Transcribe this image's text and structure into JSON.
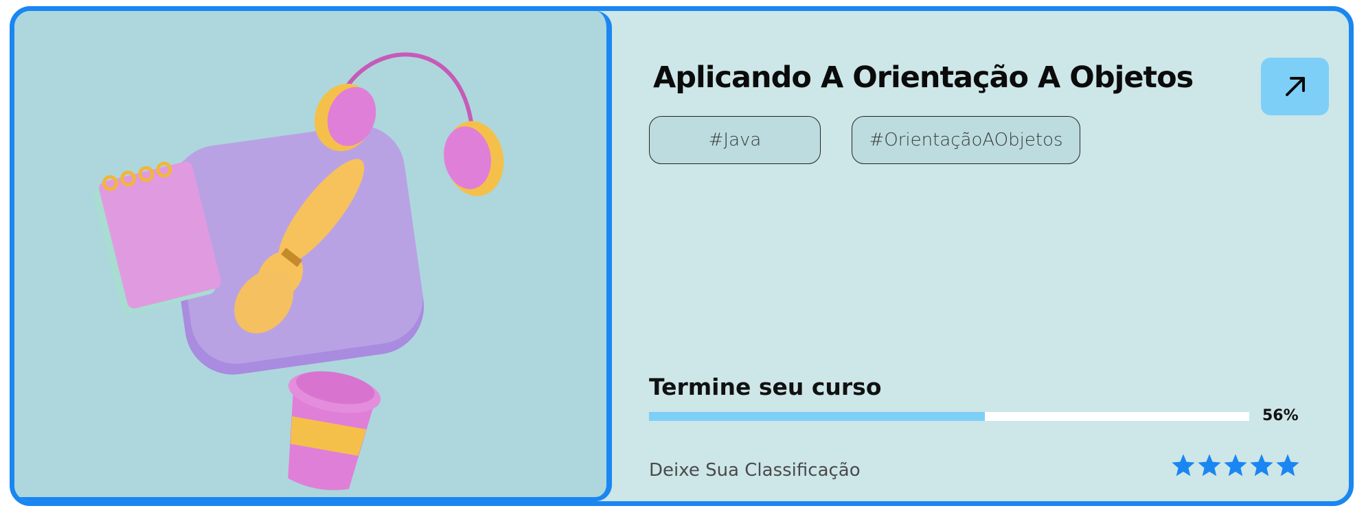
{
  "course": {
    "title": "Aplicando A Orientação A Objetos",
    "tags": [
      "#Java",
      "#OrientaçãoAObjetos"
    ],
    "open_icon": "arrow-up-right-icon"
  },
  "progress": {
    "title": "Termine seu curso",
    "percent": 56,
    "label": "56%"
  },
  "rating": {
    "label": "Deixe Sua Classificação",
    "stars": 5,
    "icon": "star-icon"
  },
  "colors": {
    "border": "#1a86f2",
    "card_background": "#cde6e8",
    "image_background": "#add7dc",
    "accent_light": "#7ecff7",
    "star": "#1a86f2"
  }
}
